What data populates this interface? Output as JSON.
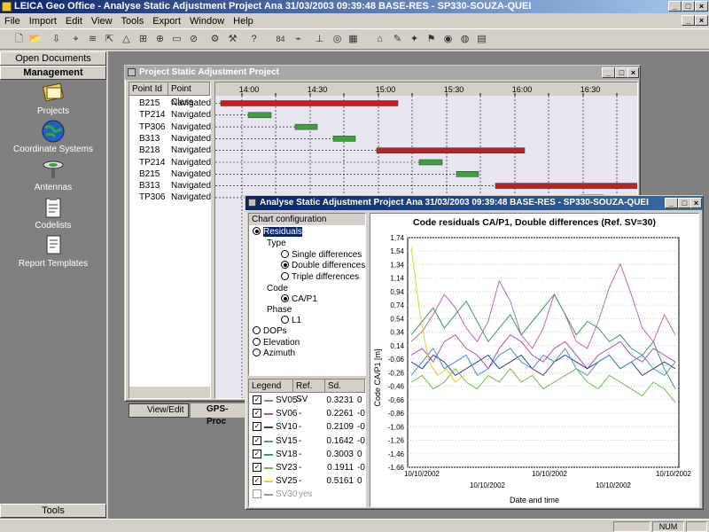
{
  "app": {
    "title": "LEICA Geo Office - Analyse Static Adjustment Project Ana 31/03/2003 09:39:48 BASE-RES - SP330-SOUZA-QUEI"
  },
  "menu": [
    "File",
    "Import",
    "Edit",
    "View",
    "Tools",
    "Export",
    "Window",
    "Help"
  ],
  "toolbar": {
    "zoom": "84"
  },
  "sidebar": {
    "open_documents": "Open Documents",
    "management": "Management",
    "items": [
      {
        "label": "Projects",
        "icon": "projects-icon"
      },
      {
        "label": "Coordinate Systems",
        "icon": "globe-icon"
      },
      {
        "label": "Antennas",
        "icon": "antenna-icon"
      },
      {
        "label": "Codelists",
        "icon": "clipboard-icon"
      },
      {
        "label": "Report Templates",
        "icon": "report-icon"
      }
    ],
    "tools": "Tools"
  },
  "project_window": {
    "title": "Project Static Adjustment Project",
    "columns": [
      "Point Id",
      "Point Class"
    ],
    "rows": [
      {
        "id": "B215",
        "cls": "Navigated"
      },
      {
        "id": "TP214",
        "cls": "Navigated"
      },
      {
        "id": "TP306",
        "cls": "Navigated"
      },
      {
        "id": "B313",
        "cls": "Navigated"
      },
      {
        "id": "B218",
        "cls": "Navigated"
      },
      {
        "id": "TP214",
        "cls": "Navigated"
      },
      {
        "id": "B215",
        "cls": "Navigated"
      },
      {
        "id": "B313",
        "cls": "Navigated"
      },
      {
        "id": "TP306",
        "cls": "Navigated"
      }
    ],
    "times": [
      "14:00",
      "14:30",
      "15:00",
      "15:30",
      "16:00",
      "16:30"
    ],
    "tabs": [
      "View/Edit",
      "GPS-Proc"
    ]
  },
  "analyse_window": {
    "title": "Analyse Static Adjustment Project Ana 31/03/2003 09:39:48 BASE-RES - SP330-SOUZA-QUEI",
    "config_header": "Chart configuration",
    "tree": {
      "residuals": "Residuals",
      "type": "Type",
      "single": "Single differences",
      "double": "Double differences",
      "triple": "Triple differences",
      "code": "Code",
      "ca": "CA/P1",
      "phase": "Phase",
      "l1": "L1",
      "dops": "DOPs",
      "elevation": "Elevation",
      "azimuth": "Azimuth"
    },
    "legend_cols": [
      "Legend",
      "Ref. SV",
      "Sd."
    ],
    "legend": [
      {
        "name": "SV05",
        "ref": "-",
        "sd": "0.3231",
        "extra": "0",
        "color": "#d05fb0"
      },
      {
        "name": "SV06",
        "ref": "-",
        "sd": "0.2261",
        "extra": "-0",
        "color": "#b050c0"
      },
      {
        "name": "SV10",
        "ref": "-",
        "sd": "0.2109",
        "extra": "-0",
        "color": "#2c3fa0"
      },
      {
        "name": "SV15",
        "ref": "-",
        "sd": "0.1642",
        "extra": "-0",
        "color": "#4a8fd0"
      },
      {
        "name": "SV18",
        "ref": "-",
        "sd": "0.3003",
        "extra": "0",
        "color": "#3a9a6a"
      },
      {
        "name": "SV23",
        "ref": "-",
        "sd": "0.1911",
        "extra": "-0",
        "color": "#6ac04a"
      },
      {
        "name": "SV25",
        "ref": "-",
        "sd": "0.5161",
        "extra": "0",
        "color": "#d8d820"
      },
      {
        "name": "SV30",
        "ref": "yes",
        "sd": "",
        "extra": "",
        "color": "#999999"
      }
    ]
  },
  "chart_data": {
    "type": "line",
    "title": "Code residuals CA/P1, Double differences (Ref. SV=30)",
    "xlabel": "Date and time",
    "ylabel": "Code CA/P1 [m]",
    "yticks": [
      "1,74",
      "1,54",
      "1,34",
      "1,14",
      "0,94",
      "0,74",
      "0,54",
      "0,34",
      "0,14",
      "-0,06",
      "-0,26",
      "-0,46",
      "-0,66",
      "-0,86",
      "-1,06",
      "-1,26",
      "-1,46",
      "-1,66"
    ],
    "xticks": [
      "10/10/2002",
      "10/10/2002",
      "10/10/2002",
      "10/10/2002",
      "10/10/2002"
    ],
    "ylim": [
      -1.66,
      1.74
    ],
    "series": [
      {
        "name": "SV05",
        "color": "#d05fb0",
        "values": [
          0.2,
          0.35,
          0.6,
          0.9,
          0.7,
          0.4,
          0.2,
          0.5,
          1.1,
          0.8,
          0.3,
          0.1,
          0.4,
          0.9,
          0.6,
          0.2,
          0.1,
          0.5,
          1.0,
          1.35,
          0.9,
          0.4,
          0.2,
          0.6,
          0.3
        ]
      },
      {
        "name": "SV06",
        "color": "#b050c0",
        "values": [
          0.0,
          0.1,
          -0.1,
          0.2,
          0.3,
          0.1,
          0.0,
          -0.2,
          0.1,
          0.3,
          0.2,
          0.0,
          -0.1,
          0.1,
          0.2,
          0.0,
          -0.2,
          0.0,
          0.1,
          0.2,
          0.0,
          -0.1,
          0.1,
          0.0,
          -0.1
        ]
      },
      {
        "name": "SV10",
        "color": "#2c3fa0",
        "values": [
          -0.1,
          -0.2,
          0.0,
          -0.1,
          -0.3,
          -0.2,
          -0.1,
          0.0,
          -0.2,
          -0.1,
          0.0,
          -0.2,
          -0.3,
          -0.1,
          0.0,
          -0.1,
          -0.2,
          -0.1,
          0.0,
          -0.2,
          -0.1,
          -0.3,
          -0.2,
          -0.1,
          -0.2
        ]
      },
      {
        "name": "SV15",
        "color": "#4a8fd0",
        "values": [
          -0.3,
          -0.1,
          0.1,
          -0.2,
          -0.1,
          0.0,
          -0.3,
          -0.2,
          0.0,
          0.1,
          -0.1,
          -0.2,
          0.0,
          -0.1,
          0.1,
          -0.2,
          -0.3,
          -0.1,
          0.0,
          -0.2,
          -0.1,
          0.0,
          -0.2,
          -0.3,
          -0.1
        ]
      },
      {
        "name": "SV18",
        "color": "#3a9a6a",
        "values": [
          0.3,
          0.5,
          0.7,
          0.4,
          0.6,
          0.8,
          0.5,
          0.2,
          0.4,
          0.6,
          0.3,
          0.5,
          0.7,
          0.9,
          0.6,
          0.3,
          0.5,
          0.4,
          0.2,
          0.3,
          0.1,
          0.0,
          0.2,
          -0.2,
          -0.5
        ]
      },
      {
        "name": "SV23",
        "color": "#6ac04a",
        "values": [
          -0.4,
          -0.3,
          -0.5,
          -0.4,
          -0.2,
          -0.4,
          -0.5,
          -0.3,
          -0.4,
          -0.2,
          -0.4,
          -0.3,
          -0.5,
          -0.4,
          -0.3,
          -0.2,
          -0.4,
          -0.5,
          -0.3,
          -0.4,
          -0.5,
          -0.6,
          -0.4,
          -0.5,
          -0.7
        ]
      },
      {
        "name": "SV25",
        "color": "#d8d820",
        "values": [
          1.6,
          0.6,
          -0.1,
          -0.3,
          -0.2,
          -0.4,
          -0.3
        ]
      }
    ]
  }
}
